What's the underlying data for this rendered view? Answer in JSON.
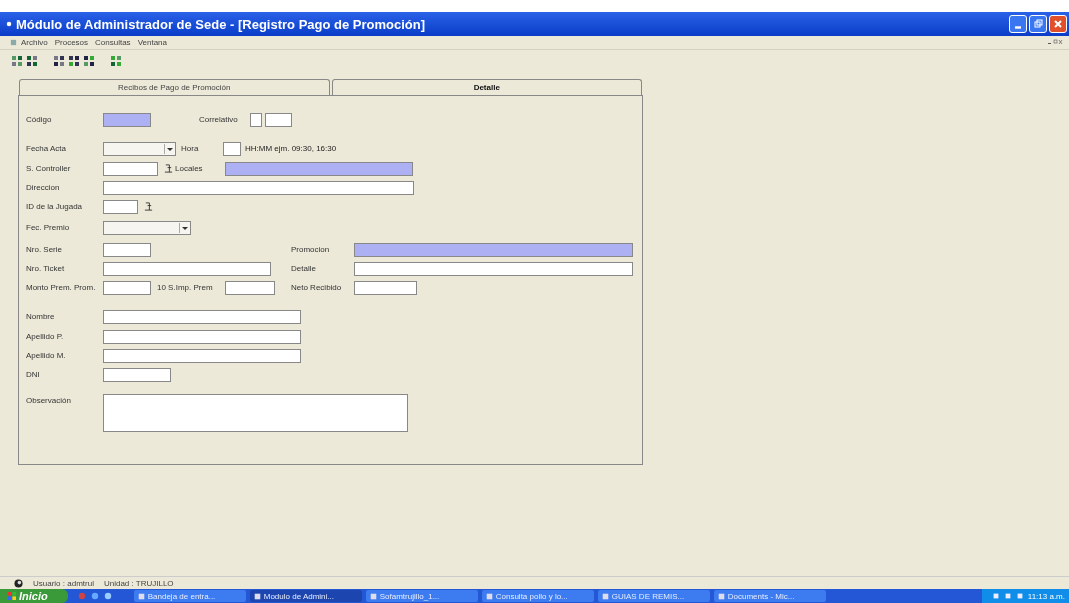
{
  "window": {
    "title": "Módulo de Administrador de Sede - [Registro Pago de Promoción]"
  },
  "menu": [
    "Archivo",
    "Procesos",
    "Consultas",
    "Ventana"
  ],
  "tabs": [
    {
      "label": "Recibos de Pago de Promoción",
      "selected": false
    },
    {
      "label": "Detalle",
      "selected": true
    }
  ],
  "form": {
    "rows": [
      [
        {
          "label": "Código",
          "fields": [
            {
              "kind": "text",
              "highlighted": true
            }
          ]
        },
        {
          "label": "Correlativo",
          "fields": [
            {
              "kind": "text",
              "highlighted": false
            },
            {
              "kind": "text",
              "highlighted": false
            }
          ]
        }
      ],
      [
        {
          "label": "Fecha Acta",
          "fields": [
            {
              "kind": "combo",
              "highlighted": false
            }
          ]
        },
        {
          "label": "Hora",
          "fields": [
            {
              "kind": "text",
              "highlighted": false
            }
          ],
          "hint": "HH:MM ejm. 09:30, 16:30"
        }
      ],
      [
        {
          "label": "S. Controller",
          "fields": [
            {
              "kind": "lookup",
              "highlighted": false
            }
          ]
        },
        {
          "label": "Locales",
          "fields": [
            {
              "kind": "text",
              "highlighted": true
            }
          ]
        }
      ],
      [
        {
          "label": "Direccion",
          "fields": [
            {
              "kind": "text",
              "highlighted": false
            }
          ]
        }
      ],
      [
        {
          "label": "ID de la Jugada",
          "fields": [
            {
              "kind": "lookup",
              "highlighted": false
            }
          ]
        }
      ],
      [
        {
          "label": "Fec. Premio",
          "fields": [
            {
              "kind": "combo",
              "highlighted": false
            }
          ]
        }
      ],
      [
        {
          "label": "Nro. Serie",
          "fields": [
            {
              "kind": "text",
              "highlighted": false
            }
          ]
        },
        {
          "label": "Promocion",
          "fields": [
            {
              "kind": "text",
              "highlighted": true
            }
          ]
        }
      ],
      [
        {
          "label": "Nro. Ticket",
          "fields": [
            {
              "kind": "text",
              "highlighted": false
            }
          ]
        },
        {
          "label": "Detalle",
          "fields": [
            {
              "kind": "text",
              "highlighted": false
            }
          ]
        }
      ],
      [
        {
          "label": "Monto Prem. Prom.",
          "fields": [
            {
              "kind": "text",
              "highlighted": false
            }
          ]
        },
        {
          "label": "10 S.Imp. Prem",
          "fields": [
            {
              "kind": "text",
              "highlighted": false
            }
          ]
        },
        {
          "label": "Neto Recibido",
          "fields": [
            {
              "kind": "text",
              "highlighted": false
            }
          ]
        }
      ],
      [
        {
          "label": "Nombre",
          "fields": [
            {
              "kind": "text",
              "highlighted": false
            }
          ]
        }
      ],
      [
        {
          "label": "Apellido P.",
          "fields": [
            {
              "kind": "text",
              "highlighted": false
            }
          ]
        }
      ],
      [
        {
          "label": "Apellido M.",
          "fields": [
            {
              "kind": "text",
              "highlighted": false
            }
          ]
        }
      ],
      [
        {
          "label": "DNI",
          "fields": [
            {
              "kind": "text",
              "highlighted": false
            }
          ]
        }
      ],
      [
        {
          "label": "Observación",
          "fields": [
            {
              "kind": "memo",
              "highlighted": false
            }
          ]
        }
      ]
    ]
  },
  "status_bar": {
    "user": "Usuario : admtrul",
    "unit": "Unidad : TRUJILLO"
  },
  "taskbar": {
    "start": "Inicio",
    "tasks": [
      {
        "label": "Bandeja de entra...",
        "selected": false
      },
      {
        "label": "Modulo de Admini...",
        "selected": true
      },
      {
        "label": "Sofamtrujillo_1...",
        "selected": false
      },
      {
        "label": "Consulta pollo y lo...",
        "selected": false
      },
      {
        "label": "GUIAS DE REMIS...",
        "selected": false
      },
      {
        "label": "Documents - Mic...",
        "selected": false
      }
    ],
    "clock": "11:13 a.m."
  }
}
